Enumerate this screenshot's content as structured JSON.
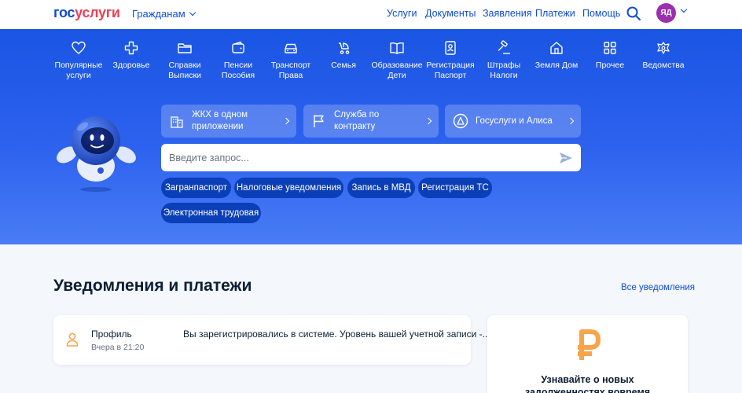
{
  "header": {
    "logo_part1": "гос",
    "logo_part2": "услуги",
    "audience": "Гражданам",
    "nav": [
      "Услуги",
      "Документы",
      "Заявления",
      "Платежи",
      "Помощь"
    ],
    "avatar_initials": "ЯД"
  },
  "categories": [
    {
      "label": "Популярные\nуслуги",
      "icon": "heart-icon"
    },
    {
      "label": "Здоровье",
      "icon": "cross-icon"
    },
    {
      "label": "Справки\nВыписки",
      "icon": "folder-icon"
    },
    {
      "label": "Пенсии\nПособия",
      "icon": "wallet-icon"
    },
    {
      "label": "Транспорт\nПрава",
      "icon": "car-icon"
    },
    {
      "label": "Семья",
      "icon": "stroller-icon"
    },
    {
      "label": "Образование\nДети",
      "icon": "book-icon"
    },
    {
      "label": "Регистрация\nПаспорт",
      "icon": "id-card-icon"
    },
    {
      "label": "Штрафы\nНалоги",
      "icon": "gavel-icon"
    },
    {
      "label": "Земля Дом",
      "icon": "house-icon"
    },
    {
      "label": "Прочее",
      "icon": "grid-icon"
    },
    {
      "label": "Ведомства",
      "icon": "emblem-icon"
    }
  ],
  "promos": [
    {
      "label": "ЖКХ в одном приложении",
      "icon": "building-icon"
    },
    {
      "label": "Служба по контракту",
      "icon": "flag-icon"
    },
    {
      "label": "Госуслуги и Алиса",
      "icon": "alice-icon"
    }
  ],
  "search": {
    "placeholder": "Введите запрос..."
  },
  "chips": [
    "Загранпаспорт",
    "Налоговые уведомления",
    "Запись в МВД",
    "Регистрация ТС",
    "Электронная трудовая"
  ],
  "section": {
    "title": "Уведомления и платежи",
    "all_link": "Все уведомления"
  },
  "notification": {
    "title": "Профиль",
    "time": "Вчера в 21:20",
    "message": "Вы зарегистрировались в системе. Уровень вашей учетной записи -..."
  },
  "payment_card": {
    "text": "Узнавайте о новых задолженностях вовремя"
  },
  "colors": {
    "brand_blue": "#0d4cd3",
    "brand_red": "#ee3f58",
    "hero_blue": "#2d62ee",
    "chip_blue": "#0b3fb8",
    "avatar_purple": "#9b2fae",
    "ruble_orange": "#f7a44a"
  }
}
